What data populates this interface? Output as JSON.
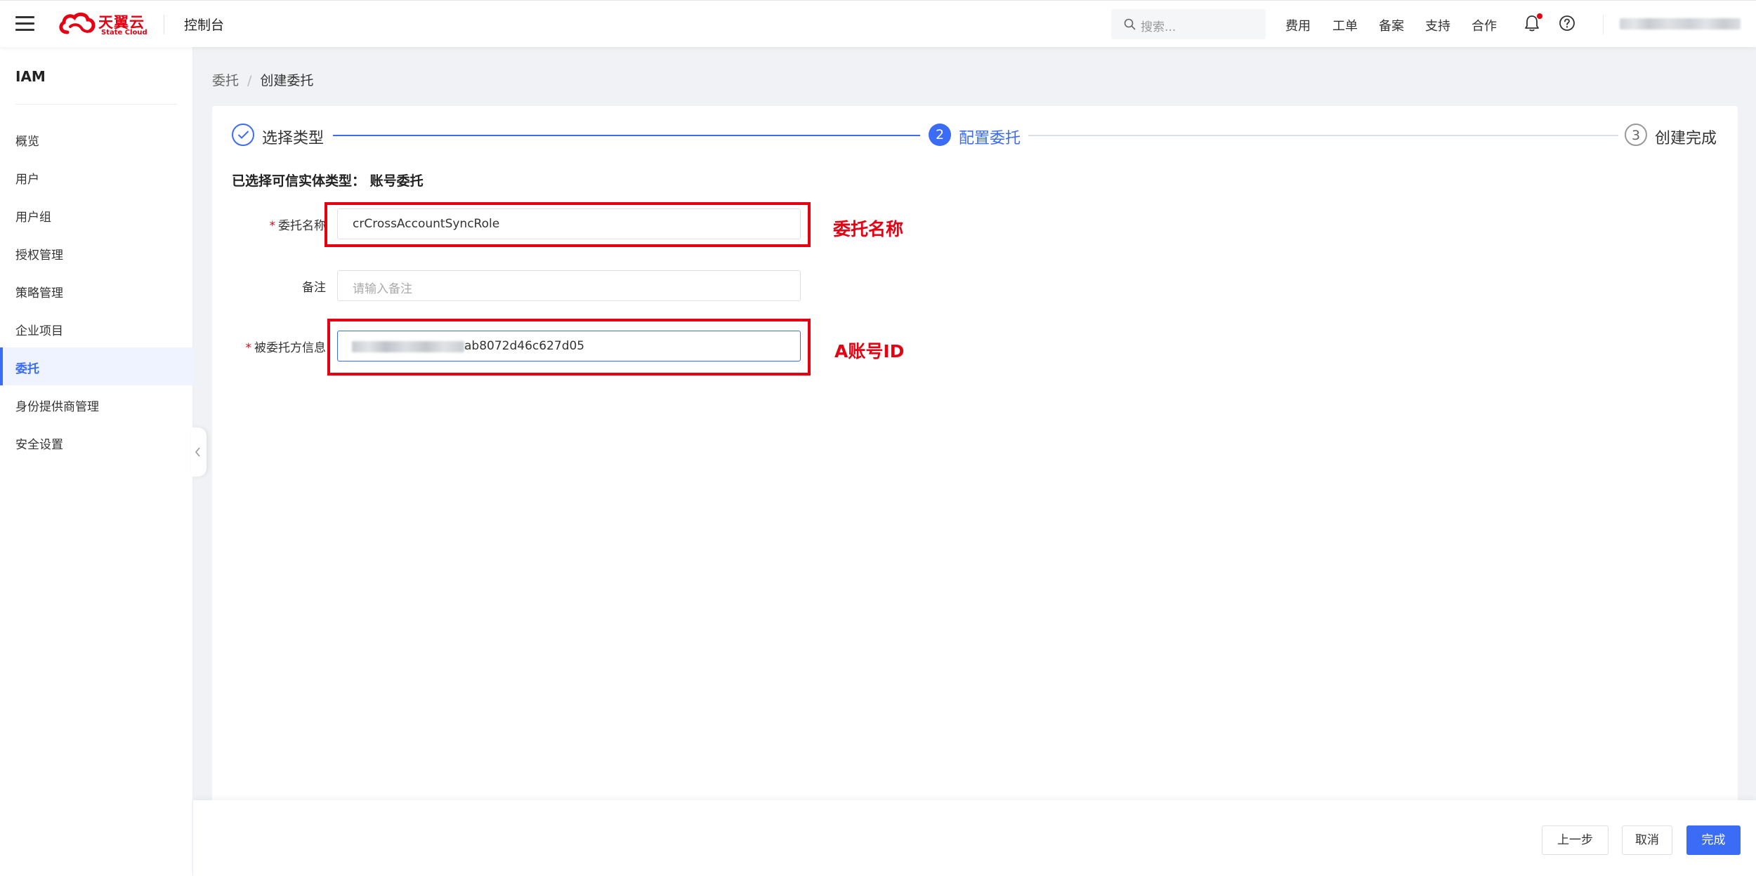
{
  "header": {
    "brand_cn": "天翼云",
    "brand_en": "State Cloud",
    "console_title": "控制台",
    "search_placeholder": "搜索...",
    "links": [
      "费用",
      "工单",
      "备案",
      "支持",
      "合作"
    ]
  },
  "sidebar": {
    "title": "IAM",
    "items": [
      {
        "label": "概览"
      },
      {
        "label": "用户"
      },
      {
        "label": "用户组"
      },
      {
        "label": "授权管理"
      },
      {
        "label": "策略管理"
      },
      {
        "label": "企业项目"
      },
      {
        "label": "委托",
        "active": true
      },
      {
        "label": "身份提供商管理"
      },
      {
        "label": "安全设置"
      }
    ]
  },
  "breadcrumb": {
    "parent": "委托",
    "separator": "/",
    "current": "创建委托"
  },
  "steps": [
    {
      "label": "选择类型",
      "status": "done"
    },
    {
      "number": "2",
      "label": "配置委托",
      "status": "active"
    },
    {
      "number": "3",
      "label": "创建完成",
      "status": "pending"
    }
  ],
  "selected_type": "已选择可信实体类型： 账号委托",
  "form": {
    "name": {
      "label": "委托名称",
      "required": "*",
      "value": "crCrossAccountSyncRole"
    },
    "remark": {
      "label": "备注",
      "placeholder": "请输入备注"
    },
    "trustee": {
      "label": "被委托方信息",
      "required": "*",
      "value_visible": "ab8072d46c627d05"
    }
  },
  "annotations": {
    "name": "委托名称",
    "account": "A账号ID"
  },
  "footer": {
    "prev": "上一步",
    "cancel": "取消",
    "finish": "完成"
  },
  "colors": {
    "brand_red": "#e60012",
    "primary_blue": "#3b6cf6"
  }
}
